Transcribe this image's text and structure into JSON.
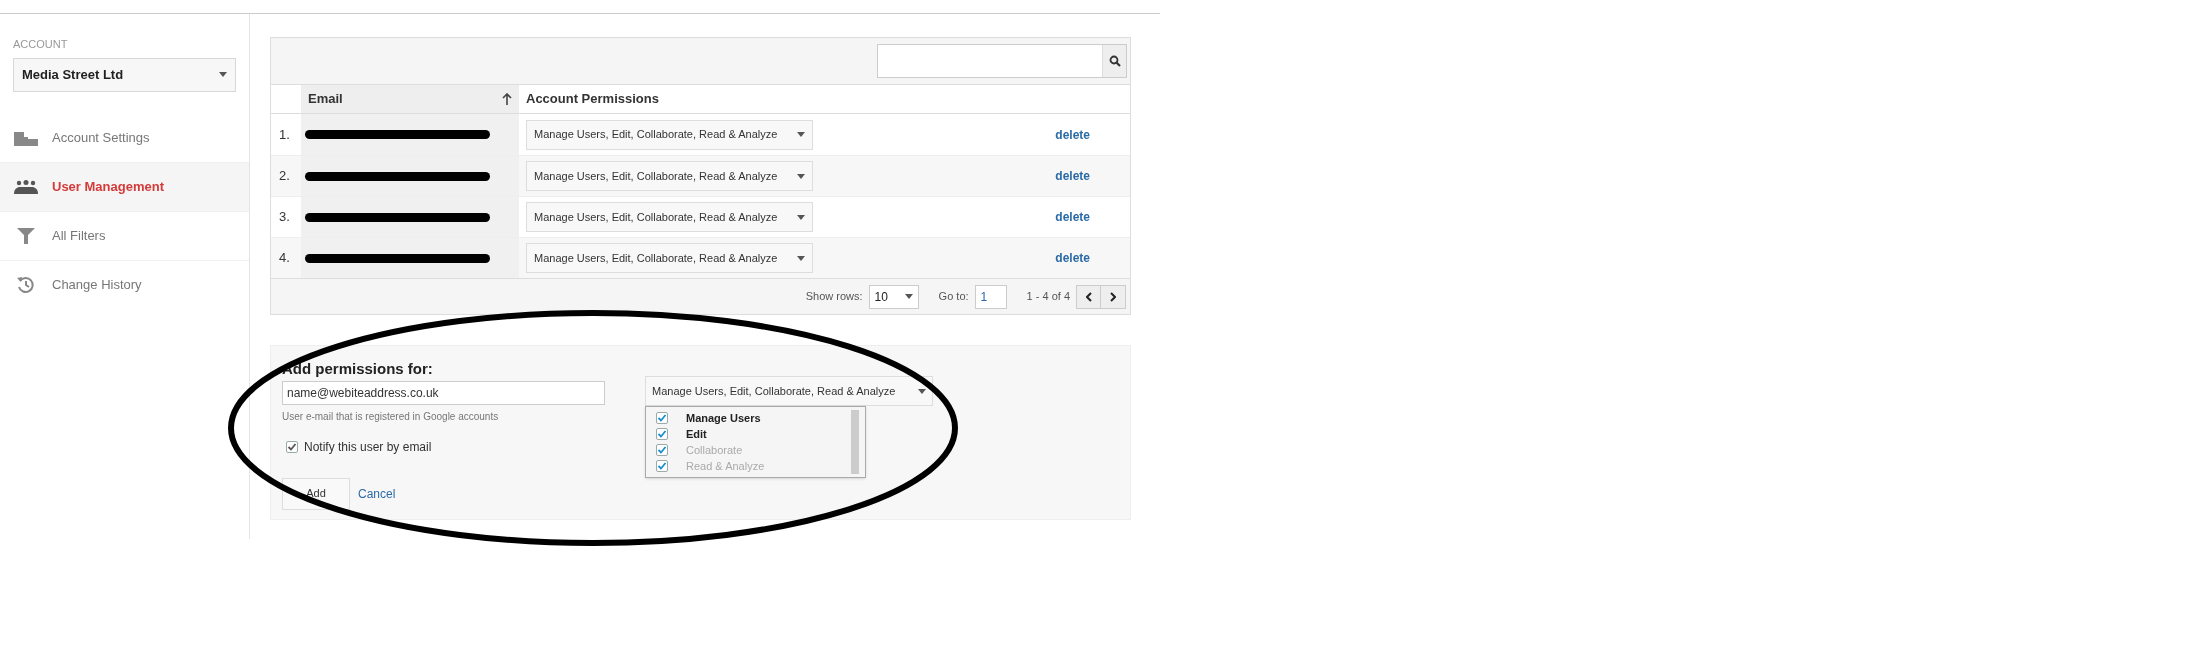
{
  "account": {
    "label": "ACCOUNT",
    "selected_account": "Media Street Ltd"
  },
  "nav": [
    {
      "label": "Account Settings",
      "selected": false
    },
    {
      "label": "User Management",
      "selected": true
    },
    {
      "label": "All Filters",
      "selected": false
    },
    {
      "label": "Change History",
      "selected": false
    }
  ],
  "users_table": {
    "columns": [
      "Email",
      "Account Permissions"
    ],
    "rows": [
      {
        "number": "1.",
        "permissions": "Manage Users, Edit, Collaborate, Read & Analyze",
        "action": "delete"
      },
      {
        "number": "2.",
        "permissions": "Manage Users, Edit, Collaborate, Read & Analyze",
        "action": "delete"
      },
      {
        "number": "3.",
        "permissions": "Manage Users, Edit, Collaborate, Read & Analyze",
        "action": "delete"
      },
      {
        "number": "4.",
        "permissions": "Manage Users, Edit, Collaborate, Read & Analyze",
        "action": "delete"
      }
    ],
    "footer": {
      "show_rows_label": "Show rows:",
      "rows_value": "10",
      "goto_label": "Go to:",
      "goto_value": "1",
      "range": "1 - 4 of 4"
    }
  },
  "add_permissions": {
    "title": "Add permissions for:",
    "email_value": "name@webiteaddress.co.uk",
    "hint": "User e-mail that is registered in Google accounts",
    "notify": {
      "label": "Notify this user by email",
      "checked": true
    },
    "permissions_select": "Manage Users, Edit, Collaborate, Read & Analyze",
    "options": [
      {
        "label": "Manage Users",
        "checked": true,
        "disabled": false
      },
      {
        "label": "Edit",
        "checked": true,
        "disabled": false
      },
      {
        "label": "Collaborate",
        "checked": true,
        "disabled": true
      },
      {
        "label": "Read & Analyze",
        "checked": true,
        "disabled": true
      }
    ],
    "buttons": [
      "Add",
      "Cancel"
    ]
  }
}
